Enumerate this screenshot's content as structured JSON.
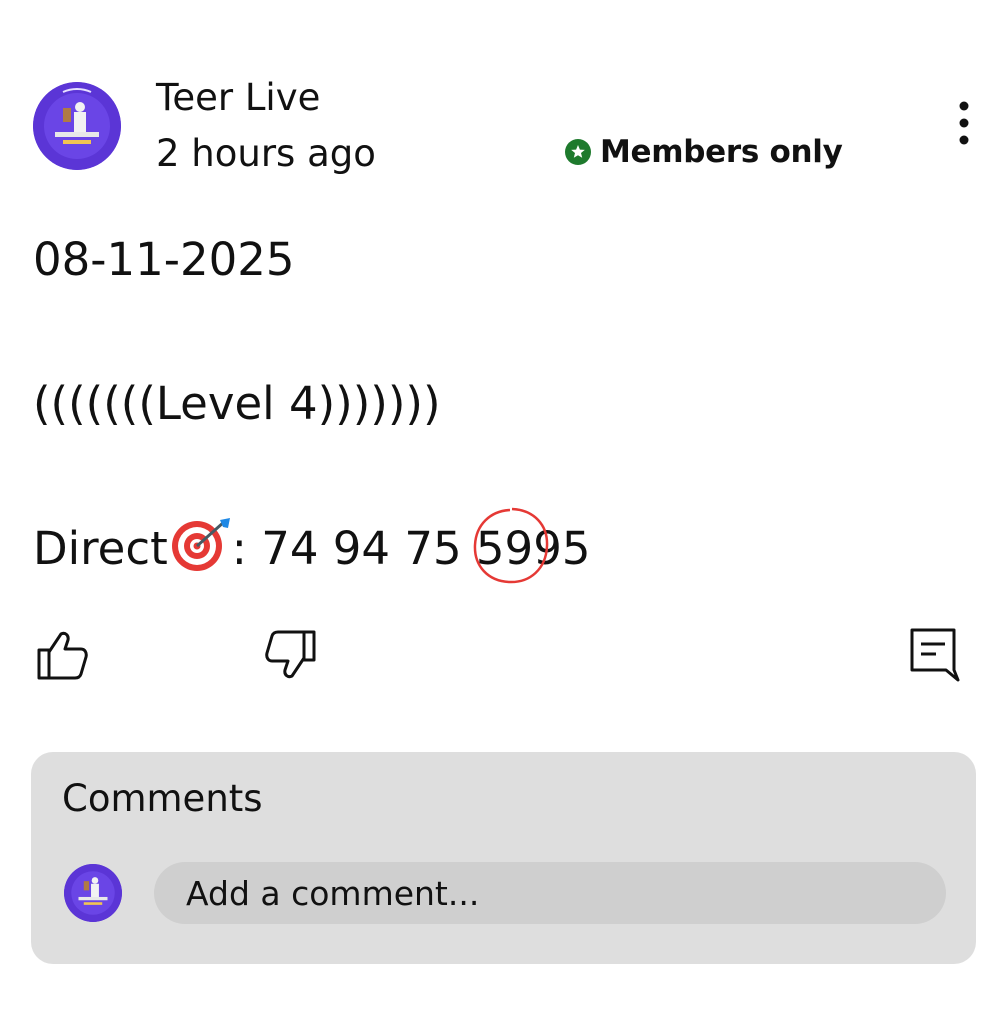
{
  "post": {
    "channel_name": "Teer Live",
    "time_ago": "2 hours ago",
    "visibility_label": "Members only",
    "date_line": "08-11-2025",
    "level_line": "(((((((Level 4)))))))",
    "direct_prefix": "Direct",
    "direct_colon": ": ",
    "numbers_before": "74 94 75 ",
    "circled_number": "59",
    "numbers_after": "95"
  },
  "icons": {
    "avatar": "channel-logo",
    "visibility": "star-circle-icon",
    "more": "vertical-ellipsis-icon",
    "target_emoji": "direct-hit-emoji",
    "like": "thumb-up-icon",
    "dislike": "thumb-down-icon",
    "comment": "comment-icon"
  },
  "comments": {
    "title": "Comments",
    "placeholder": "Add a comment..."
  },
  "colors": {
    "avatar_bg": "#5b35d6",
    "badge_green": "#1e7a2d",
    "circle_red": "#e53935",
    "panel_bg": "#dedede",
    "input_bg": "#cfcfcf"
  }
}
